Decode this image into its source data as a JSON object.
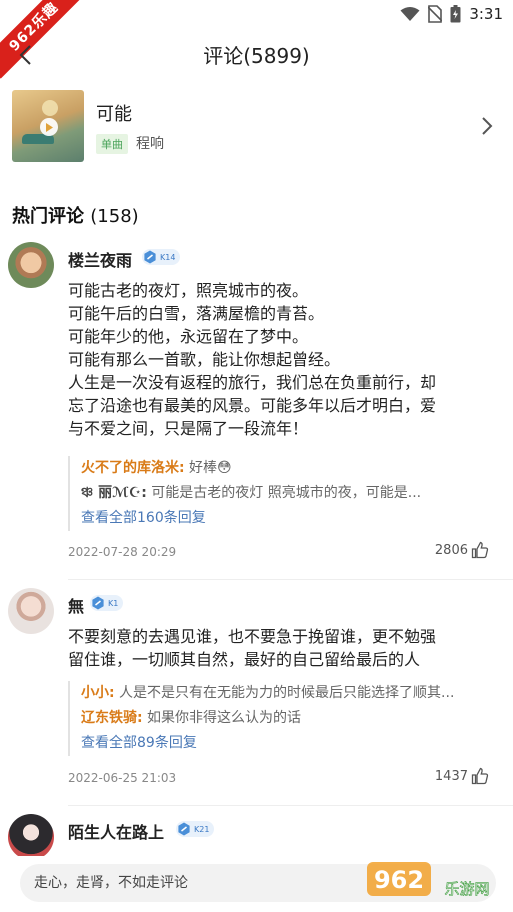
{
  "status_bar": {
    "time": "3:31"
  },
  "corner_badge": "962乐趣",
  "header": {
    "title": "评论(5899)"
  },
  "song": {
    "title": "可能",
    "tag": "单曲",
    "artist": "程响"
  },
  "hot_section": {
    "title": "热门评论",
    "count": "(158)"
  },
  "comments": [
    {
      "user": "楼兰夜雨",
      "level": "K14",
      "lines": [
        "可能古老的夜灯，照亮城市的夜。",
        "可能午后的白雪，落满屋檐的青苔。",
        "可能年少的他，永远留在了梦中。",
        "可能有那么一首歌，能让你想起曾经。",
        "人生是一次没有返程的旅行，我们总在负重前行，却",
        "忘了沿途也有最美的风景。可能多年以后才明白，爱",
        "与不爱之间，只是隔了一段流年！"
      ],
      "replies": [
        {
          "name": "火不了的库洛米:",
          "text": " 好棒😳"
        },
        {
          "name": "ঞ্চ 丽ℳ☪:",
          "text": " 可能是古老的夜灯 照亮城市的夜，可能是..."
        }
      ],
      "view_all": "查看全部160条回复",
      "date": "2022-07-28 20:29",
      "likes": "2806"
    },
    {
      "user": "無",
      "level": "K1",
      "lines": [
        "不要刻意的去遇见谁，也不要急于挽留谁，更不勉强",
        "留住谁，一切顺其自然，最好的自己留给最后的人"
      ],
      "replies": [
        {
          "name": "小小:",
          "text": " 人是不是只有在无能为力的时候最后只能选择了顺其..."
        },
        {
          "name": "辽东铁骑:",
          "text": " 如果你非得这么认为的话"
        }
      ],
      "view_all": "查看全部89条回复",
      "date": "2022-06-25 21:03",
      "likes": "1437"
    },
    {
      "user": "陌生人在路上",
      "level": "K21"
    }
  ],
  "input": {
    "placeholder": "走心，走肾，不如走评论"
  },
  "watermark": {
    "text": "962",
    "sub": "乐游网"
  },
  "colors": {
    "accent_blue": "#4a78b6",
    "reply_name": "#d97b18",
    "tag_green": "#4aa35a",
    "badge_red": "#d9211b"
  },
  "icons": [
    "wifi-icon",
    "no-sim-icon",
    "battery-icon",
    "back-arrow-icon",
    "play-icon",
    "chevron-right-icon",
    "level-hex-icon",
    "thumbs-up-icon"
  ]
}
